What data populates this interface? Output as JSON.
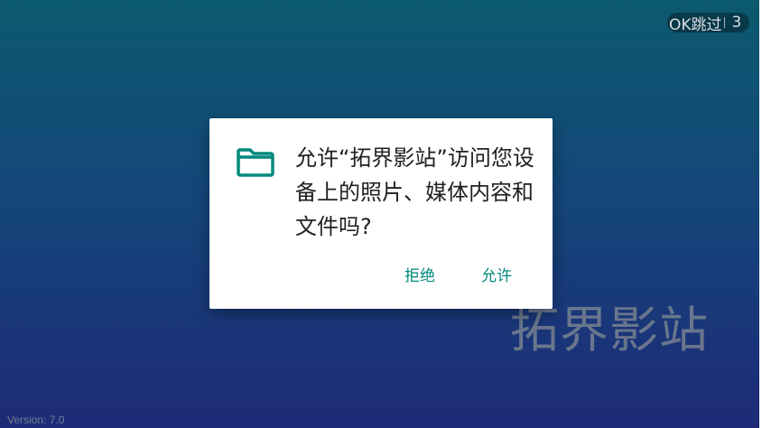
{
  "skip": {
    "label": "OK跳过",
    "countdown": "3"
  },
  "watermark": {
    "text": "拓界影站"
  },
  "version": {
    "text": "Version: 7.0"
  },
  "dialog": {
    "icon": "folder-icon",
    "message": "允许“拓界影站”访问您设备上的照片、媒体内容和文件吗?",
    "deny_label": "拒绝",
    "allow_label": "允许"
  },
  "colors": {
    "accent": "#00897b",
    "background_top": "#0c5a6e",
    "background_bottom": "#1e2a78"
  }
}
